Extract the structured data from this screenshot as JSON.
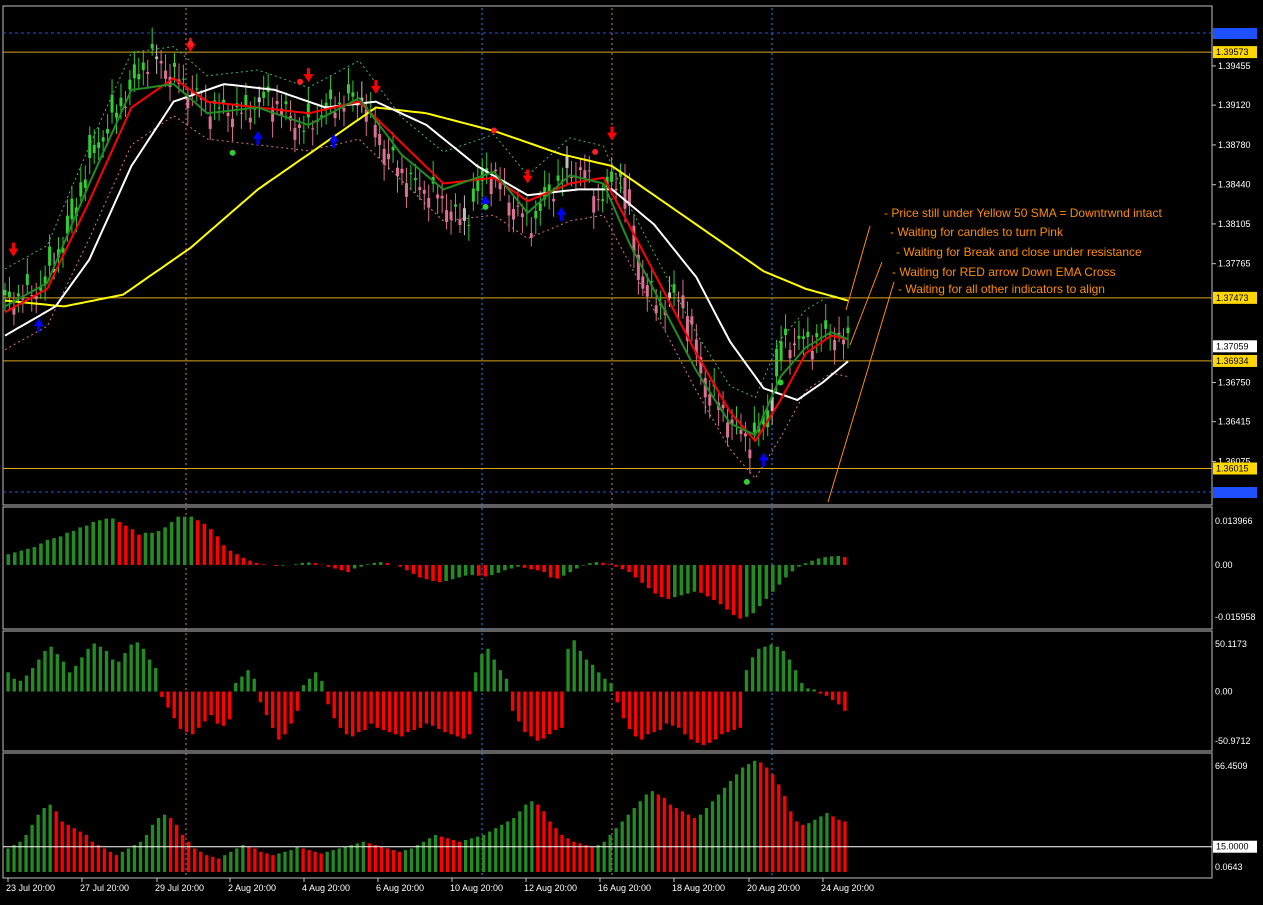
{
  "colors": {
    "background": "#000000",
    "frame": "#c0c0c0",
    "bull_candle": "#32cd32",
    "bear_candle": "#db7093",
    "neutral_candle": "#c0c0c0",
    "ema_fast": "#228b22",
    "ema_slow": "#ff0000",
    "sma_white": "#ffffff",
    "sma_50": "#ffff00",
    "hline": "#daa520",
    "annotation": "#ff8c00",
    "hist_up": "#228b22",
    "hist_down": "#ff0000",
    "vline_blue": "#1e90ff",
    "vline_pink": "#db7093"
  },
  "annotations": [
    "- Price still under Yellow 50 SMA = Downtrwnd intact",
    "- Waiting for candles to turn Pink",
    "- Waiting for Break and close under resistance",
    "- Waiting for RED arrow Down EMA Cross",
    "- Waiting for all other indicators to align"
  ],
  "chart_data": [
    {
      "type": "candlestick",
      "name": "main price panel",
      "price_labels": [
        "1.39573",
        "1.39455",
        "1.39120",
        "1.38780",
        "1.38440",
        "1.38105",
        "1.37765",
        "1.37473",
        "1.37059",
        "1.36934",
        "1.36750",
        "1.36415",
        "1.36075",
        "1.36015"
      ],
      "price_values": [
        1.39573,
        1.39455,
        1.3912,
        1.3878,
        1.3844,
        1.38105,
        1.37765,
        1.37473,
        1.37059,
        1.36934,
        1.3675,
        1.36415,
        1.36075,
        1.36015
      ],
      "current_price": "1.37059",
      "horizontal_levels": [
        "1.39573",
        "1.37473",
        "1.36934",
        "1.36015"
      ],
      "ylim": [
        1.3572,
        1.3995
      ],
      "close_path": [
        [
          0,
          1.3745
        ],
        [
          0.04,
          1.3755
        ],
        [
          0.07,
          1.38
        ],
        [
          0.1,
          1.387
        ],
        [
          0.14,
          1.392
        ],
        [
          0.17,
          1.3955
        ],
        [
          0.2,
          1.3935
        ],
        [
          0.24,
          1.391
        ],
        [
          0.28,
          1.3905
        ],
        [
          0.31,
          1.392
        ],
        [
          0.35,
          1.389
        ],
        [
          0.38,
          1.391
        ],
        [
          0.42,
          1.392
        ],
        [
          0.45,
          1.387
        ],
        [
          0.48,
          1.3845
        ],
        [
          0.51,
          1.3835
        ],
        [
          0.54,
          1.381
        ],
        [
          0.57,
          1.386
        ],
        [
          0.6,
          1.3825
        ],
        [
          0.62,
          1.381
        ],
        [
          0.65,
          1.3845
        ],
        [
          0.68,
          1.386
        ],
        [
          0.7,
          1.383
        ],
        [
          0.73,
          1.3855
        ],
        [
          0.75,
          1.377
        ],
        [
          0.77,
          1.374
        ],
        [
          0.8,
          1.375
        ],
        [
          0.83,
          1.367
        ],
        [
          0.86,
          1.364
        ],
        [
          0.88,
          1.3625
        ],
        [
          0.9,
          1.364
        ],
        [
          0.92,
          1.371
        ],
        [
          0.95,
          1.371
        ],
        [
          0.98,
          1.3718
        ],
        [
          1.0,
          1.3706
        ]
      ],
      "sma50_path": [
        [
          0,
          1.3745
        ],
        [
          0.07,
          1.374
        ],
        [
          0.14,
          1.375
        ],
        [
          0.22,
          1.379
        ],
        [
          0.3,
          1.384
        ],
        [
          0.38,
          1.388
        ],
        [
          0.44,
          1.391
        ],
        [
          0.5,
          1.3905
        ],
        [
          0.58,
          1.389
        ],
        [
          0.66,
          1.387
        ],
        [
          0.72,
          1.386
        ],
        [
          0.78,
          1.383
        ],
        [
          0.84,
          1.38
        ],
        [
          0.9,
          1.377
        ],
        [
          0.95,
          1.3755
        ],
        [
          1.0,
          1.3745
        ]
      ],
      "white_sma_path": [
        [
          0,
          1.3715
        ],
        [
          0.06,
          1.374
        ],
        [
          0.1,
          1.378
        ],
        [
          0.15,
          1.386
        ],
        [
          0.2,
          1.3915
        ],
        [
          0.26,
          1.393
        ],
        [
          0.32,
          1.3925
        ],
        [
          0.38,
          1.391
        ],
        [
          0.44,
          1.3915
        ],
        [
          0.5,
          1.3895
        ],
        [
          0.56,
          1.386
        ],
        [
          0.62,
          1.3835
        ],
        [
          0.68,
          1.384
        ],
        [
          0.72,
          1.384
        ],
        [
          0.77,
          1.381
        ],
        [
          0.82,
          1.3765
        ],
        [
          0.86,
          1.371
        ],
        [
          0.9,
          1.367
        ],
        [
          0.94,
          1.366
        ],
        [
          0.97,
          1.3675
        ],
        [
          1.0,
          1.3693
        ]
      ],
      "ema_red_path": [
        [
          0,
          1.3735
        ],
        [
          0.05,
          1.3755
        ],
        [
          0.1,
          1.383
        ],
        [
          0.15,
          1.391
        ],
        [
          0.2,
          1.3935
        ],
        [
          0.24,
          1.3915
        ],
        [
          0.3,
          1.391
        ],
        [
          0.36,
          1.3905
        ],
        [
          0.42,
          1.3915
        ],
        [
          0.47,
          1.388
        ],
        [
          0.52,
          1.3845
        ],
        [
          0.58,
          1.385
        ],
        [
          0.62,
          1.383
        ],
        [
          0.67,
          1.3845
        ],
        [
          0.71,
          1.385
        ],
        [
          0.74,
          1.381
        ],
        [
          0.78,
          1.3755
        ],
        [
          0.82,
          1.37
        ],
        [
          0.86,
          1.365
        ],
        [
          0.89,
          1.3625
        ],
        [
          0.92,
          1.366
        ],
        [
          0.95,
          1.37
        ],
        [
          0.98,
          1.3715
        ],
        [
          1.0,
          1.3712
        ]
      ],
      "ema_green_path": [
        [
          0,
          1.374
        ],
        [
          0.05,
          1.376
        ],
        [
          0.1,
          1.3845
        ],
        [
          0.15,
          1.3925
        ],
        [
          0.2,
          1.393
        ],
        [
          0.24,
          1.3905
        ],
        [
          0.3,
          1.391
        ],
        [
          0.36,
          1.3895
        ],
        [
          0.42,
          1.3918
        ],
        [
          0.47,
          1.387
        ],
        [
          0.52,
          1.384
        ],
        [
          0.58,
          1.3855
        ],
        [
          0.62,
          1.382
        ],
        [
          0.67,
          1.3852
        ],
        [
          0.71,
          1.3845
        ],
        [
          0.74,
          1.3795
        ],
        [
          0.78,
          1.374
        ],
        [
          0.82,
          1.3685
        ],
        [
          0.86,
          1.364
        ],
        [
          0.89,
          1.363
        ],
        [
          0.92,
          1.368
        ],
        [
          0.95,
          1.3705
        ],
        [
          0.98,
          1.3718
        ],
        [
          1.0,
          1.3712
        ]
      ],
      "arrows_down": [
        0.01,
        0.22,
        0.36,
        0.44,
        0.62,
        0.72
      ],
      "arrows_up": [
        0.04,
        0.3,
        0.39,
        0.57,
        0.66,
        0.9
      ],
      "dots_red": [
        0.22,
        0.35,
        0.58,
        0.7
      ],
      "dots_green": [
        0.27,
        0.57,
        0.88,
        0.92
      ]
    },
    {
      "type": "histogram",
      "name": "oscillator 1",
      "top_label": "0.013966",
      "zero_label": "0.00",
      "bottom_label": "-0.015958",
      "ylim": [
        -0.015958,
        0.013966
      ],
      "values": [
        0.003,
        0.0035,
        0.004,
        0.0045,
        0.005,
        0.006,
        0.007,
        0.0075,
        0.008,
        0.009,
        0.0095,
        0.0105,
        0.011,
        0.012,
        0.0125,
        0.013,
        0.013,
        0.012,
        0.011,
        0.01,
        0.0085,
        0.009,
        0.009,
        0.0095,
        0.0105,
        0.012,
        0.0135,
        0.0135,
        0.0135,
        0.0125,
        0.0115,
        0.01,
        0.008,
        0.0055,
        0.004,
        0.003,
        0.002,
        0.0012,
        0.0006,
        0.0002,
        0.0,
        -0.0003,
        -0.0002,
        0.0,
        0.0002,
        0.0006,
        0.0007,
        0.0005,
        0.0001,
        -0.0005,
        -0.001,
        -0.0015,
        -0.002,
        -0.001,
        -0.0005,
        0.0002,
        0.0006,
        0.0008,
        0.0005,
        0.0,
        -0.0005,
        -0.0015,
        -0.0025,
        -0.0035,
        -0.004,
        -0.0045,
        -0.0048,
        -0.0045,
        -0.004,
        -0.0035,
        -0.003,
        -0.0028,
        -0.003,
        -0.0032,
        -0.0028,
        -0.0022,
        -0.0015,
        -0.001,
        -0.0005,
        -0.0008,
        -0.0012,
        -0.0015,
        -0.002,
        -0.0035,
        -0.0038,
        -0.003,
        -0.002,
        -0.001,
        -0.0002,
        0.0005,
        0.0008,
        0.0006,
        0.0002,
        -0.0005,
        -0.0012,
        -0.002,
        -0.0035,
        -0.005,
        -0.0065,
        -0.008,
        -0.009,
        -0.0095,
        -0.009,
        -0.0085,
        -0.008,
        -0.0075,
        -0.0078,
        -0.0088,
        -0.0098,
        -0.011,
        -0.0125,
        -0.014,
        -0.015,
        -0.0145,
        -0.0135,
        -0.0115,
        -0.0095,
        -0.0075,
        -0.0055,
        -0.0035,
        -0.0018,
        -0.0005,
        0.0005,
        0.0012,
        0.0018,
        0.0022,
        0.0024,
        0.0025,
        0.0022
      ],
      "colors": "alternating by slope: green when rising, red when falling"
    },
    {
      "type": "histogram",
      "name": "oscillator 2",
      "top_label": "50.1173",
      "zero_label": "0.00",
      "bottom_label": "-50.9712",
      "ylim": [
        -50.9712,
        50.1173
      ],
      "values": [
        18,
        12,
        10,
        15,
        22,
        30,
        38,
        42,
        35,
        28,
        18,
        24,
        32,
        40,
        45,
        42,
        38,
        30,
        28,
        36,
        44,
        46,
        40,
        30,
        22,
        -5,
        -15,
        -25,
        -35,
        -38,
        -40,
        -34,
        -28,
        -22,
        -30,
        -32,
        -26,
        8,
        14,
        20,
        12,
        -10,
        -22,
        -34,
        -45,
        -40,
        -30,
        -18,
        6,
        12,
        18,
        10,
        -12,
        -25,
        -34,
        -40,
        -42,
        -38,
        -36,
        -30,
        -34,
        -36,
        -38,
        -40,
        -42,
        -38,
        -36,
        -34,
        -30,
        -32,
        -35,
        -38,
        -40,
        -42,
        -44,
        -40,
        18,
        35,
        40,
        30,
        20,
        12,
        -18,
        -28,
        -38,
        -42,
        -46,
        -44,
        -40,
        -36,
        -34,
        40,
        48,
        38,
        30,
        25,
        18,
        12,
        8,
        -10,
        -25,
        -35,
        -42,
        -45,
        -40,
        -38,
        -36,
        -30,
        -32,
        -34,
        -40,
        -45,
        -48,
        -50,
        -48,
        -45,
        -40,
        -38,
        -36,
        -34,
        20,
        32,
        40,
        42,
        44,
        42,
        38,
        30,
        20,
        8,
        3,
        2,
        -2,
        -4,
        -8,
        -12,
        -18
      ],
      "colors": "green above zero, red below zero"
    },
    {
      "type": "histogram",
      "name": "oscillator 3",
      "top_label": "66.4509",
      "level_label": "15.0000",
      "bottom_label": "0.0643",
      "ylim": [
        0,
        66.4509
      ],
      "values": [
        14,
        16,
        18,
        22,
        28,
        34,
        38,
        40,
        36,
        30,
        28,
        26,
        24,
        22,
        18,
        16,
        14,
        12,
        10,
        12,
        14,
        16,
        18,
        22,
        28,
        32,
        34,
        32,
        28,
        22,
        18,
        14,
        12,
        10,
        9,
        8,
        10,
        12,
        14,
        16,
        15,
        14,
        12,
        11,
        10,
        11,
        12,
        13,
        15,
        14,
        13,
        12,
        11,
        12,
        13,
        14,
        15,
        16,
        17,
        18,
        17,
        16,
        15,
        14,
        13,
        12,
        13,
        14,
        16,
        18,
        20,
        22,
        21,
        20,
        19,
        18,
        19,
        20,
        21,
        22,
        24,
        26,
        28,
        30,
        32,
        36,
        40,
        42,
        40,
        36,
        30,
        26,
        22,
        20,
        18,
        17,
        16,
        15,
        16,
        18,
        22,
        26,
        30,
        34,
        38,
        42,
        46,
        48,
        46,
        44,
        40,
        38,
        36,
        34,
        32,
        34,
        38,
        42,
        46,
        50,
        54,
        58,
        62,
        64,
        66,
        65,
        62,
        58,
        52,
        45,
        36,
        30,
        28,
        29,
        31,
        33,
        35,
        33,
        31,
        30
      ],
      "colors": "green rising, red falling"
    }
  ],
  "time_labels": [
    "23 Jul 20:00",
    "27 Jul 20:00",
    "29 Jul 20:00",
    "2 Aug 20:00",
    "4 Aug 20:00",
    "6 Aug 20:00",
    "10 Aug 20:00",
    "12 Aug 20:00",
    "16 Aug 20:00",
    "18 Aug 20:00",
    "20 Aug 20:00",
    "24 Aug 20:00"
  ]
}
